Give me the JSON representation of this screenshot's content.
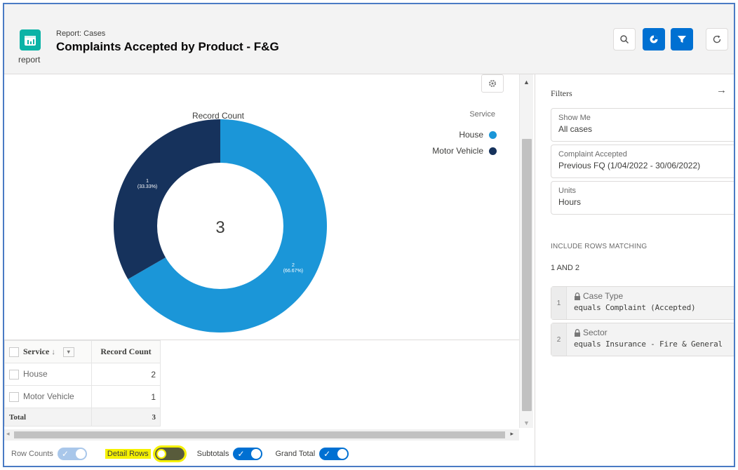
{
  "header": {
    "app_label": "report",
    "breadcrumb": "Report: Cases",
    "title": "Complaints Accepted by Product - F&G",
    "buttons": [
      "search-icon",
      "chart-icon",
      "filter-icon",
      "refresh-icon"
    ]
  },
  "chart_data": {
    "type": "pie",
    "variant": "donut",
    "title": "Record Count",
    "center_label": "3",
    "legend_title": "Service",
    "legend_placement": "top-right",
    "categories": [
      "House",
      "Motor Vehicle"
    ],
    "values": [
      2,
      1
    ],
    "slice_labels": [
      "2\n(66.67%)",
      "1\n(33.33%)"
    ],
    "colors": [
      "#1b96d8",
      "#16325c"
    ]
  },
  "table": {
    "headers": [
      "Service",
      "Record Count"
    ],
    "sort_indicator": "↓",
    "rows": [
      {
        "label": "House",
        "value": "2"
      },
      {
        "label": "Motor Vehicle",
        "value": "1"
      }
    ],
    "total": {
      "label": "Total",
      "value": "3"
    }
  },
  "toggles": {
    "row_counts": {
      "label": "Row Counts",
      "state": "on-disabled"
    },
    "detail_rows": {
      "label": "Detail Rows",
      "state": "off"
    },
    "subtotals": {
      "label": "Subtotals",
      "state": "on"
    },
    "grand_total": {
      "label": "Grand Total",
      "state": "on"
    }
  },
  "filters": {
    "title": "Filters",
    "cards": [
      {
        "label": "Show Me",
        "value": "All cases"
      },
      {
        "label": "Complaint Accepted",
        "value": "Previous FQ (1/04/2022 - 30/06/2022)"
      },
      {
        "label": "Units",
        "value": "Hours"
      }
    ],
    "include_label": "INCLUDE ROWS MATCHING",
    "logic": "1 AND 2",
    "conditions": [
      {
        "num": "1",
        "label": "Case Type",
        "value": "equals Complaint (Accepted)"
      },
      {
        "num": "2",
        "label": "Sector",
        "value": "equals Insurance - Fire & General"
      }
    ]
  },
  "colors": {
    "accent": "#0070d2",
    "house": "#1b96d8",
    "motor_vehicle": "#16325c",
    "highlight": "#f5f100"
  }
}
